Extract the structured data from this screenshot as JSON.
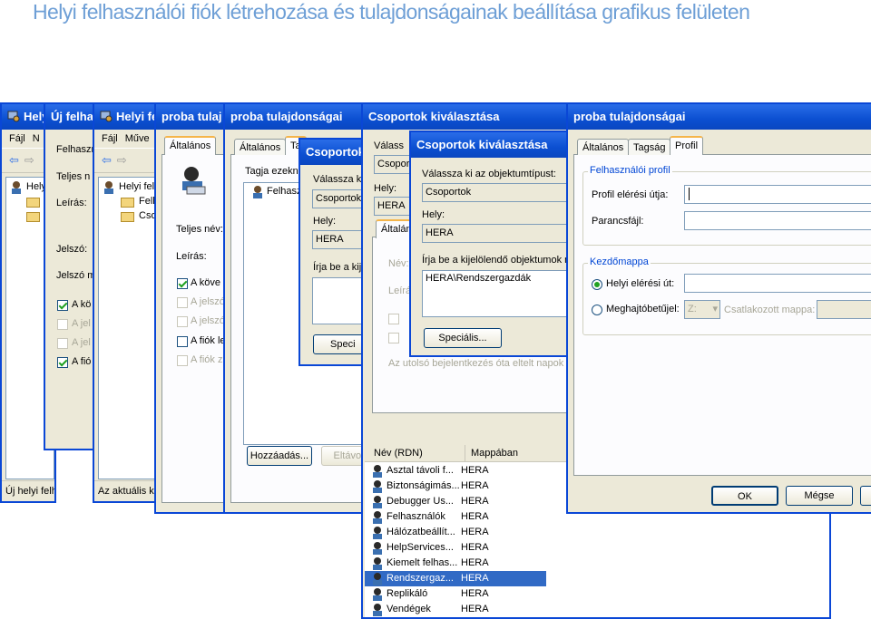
{
  "slide": {
    "title": "Helyi felhasználói fiók létrehozása és tulajdonságainak beállítása grafikus felületen"
  },
  "win1": {
    "title": "Hely",
    "menu": [
      "Fájl",
      "N"
    ],
    "tree": [
      "Hely"
    ],
    "status": "Új helyi felhasználói"
  },
  "win2": {
    "title": "Új felha",
    "labels": {
      "username": "Felhaszn",
      "fullname": "Teljes n",
      "desc": "Leírás:",
      "password": "Jelszó:",
      "password_confirm": "Jelszó m"
    },
    "checks": [
      {
        "label": "A kö",
        "checked": true,
        "disabled": false
      },
      {
        "label": "A jel",
        "checked": false,
        "disabled": true
      },
      {
        "label": "A jel",
        "checked": false,
        "disabled": true
      },
      {
        "label": "A fió",
        "checked": true,
        "disabled": false
      }
    ]
  },
  "win3": {
    "title": "Helyi fe",
    "menu": [
      "Fájl",
      "Műve"
    ],
    "tree": [
      "Helyi fel",
      "Felh",
      "Csop"
    ],
    "status": "Az aktuális ki"
  },
  "win4": {
    "title": "proba tulaj",
    "tab": "Általános",
    "labels": {
      "fullname": "Teljes név:",
      "desc": "Leírás:"
    },
    "checks": [
      {
        "label": "A köve",
        "checked": true,
        "disabled": false
      },
      {
        "label": "A jelszó",
        "checked": false,
        "disabled": true
      },
      {
        "label": "A jelszó",
        "checked": false,
        "disabled": true
      },
      {
        "label": "A fiók le",
        "checked": false,
        "disabled": false
      },
      {
        "label": "A fiók z",
        "checked": false,
        "disabled": true
      }
    ]
  },
  "win5": {
    "title": "proba tulajdonságai",
    "tabs": [
      "Általános",
      "Ta"
    ],
    "member_label": "Tagja ezekn",
    "member_item": "Felhasz",
    "add_button": "Hozzáadás...",
    "remove_button": "Eltávol"
  },
  "win6": {
    "title": "Csoportok",
    "choose_label": "Válassza ki",
    "type_value": "Csoportok",
    "location_label": "Hely:",
    "location_value": "HERA",
    "enter_label": "Írja be a kije",
    "advanced_button": "Speci"
  },
  "win7": {
    "title": "Csoportok kiválasztása",
    "choose_label": "Válass",
    "type_value": "Csopor",
    "location_label": "Hely:",
    "location_value": "HERA",
    "tab": "Általán",
    "name_label": "Név:",
    "desc_label": "Leírá",
    "last_login_text": "Az utolsó bejelentkezés óta eltelt napok s",
    "columns": [
      "Név (RDN)",
      "Mappában"
    ],
    "rows": [
      {
        "name": "Asztal távoli f...",
        "folder": "HERA",
        "selected": false
      },
      {
        "name": "Biztonságimás...",
        "folder": "HERA",
        "selected": false
      },
      {
        "name": "Debugger Us...",
        "folder": "HERA",
        "selected": false
      },
      {
        "name": "Felhasználók",
        "folder": "HERA",
        "selected": false
      },
      {
        "name": "Hálózatbeállít...",
        "folder": "HERA",
        "selected": false
      },
      {
        "name": "HelpServices...",
        "folder": "HERA",
        "selected": false
      },
      {
        "name": "Kiemelt felhas...",
        "folder": "HERA",
        "selected": false
      },
      {
        "name": "Rendszergaz...",
        "folder": "HERA",
        "selected": true
      },
      {
        "name": "Replikáló",
        "folder": "HERA",
        "selected": false
      },
      {
        "name": "Vendégek",
        "folder": "HERA",
        "selected": false
      }
    ]
  },
  "win8": {
    "title": "Csoportok kiválasztása",
    "type_label": "Válassza ki az objektumtípust:",
    "type_value": "Csoportok",
    "location_label": "Hely:",
    "location_value": "HERA",
    "enter_label": "Írja be a kijelölendő objektumok n",
    "entered_value": "HERA\\Rendszergazdák",
    "advanced_button": "Speciális..."
  },
  "win9": {
    "title": "proba tulajdonságai",
    "tabs": [
      "Általános",
      "Tagság",
      "Profil"
    ],
    "profile_group": "Felhasználói profil",
    "profile_path_label": "Profil elérési útja:",
    "logon_script_label": "Parancsfájl:",
    "home_group": "Kezdőmappa",
    "local_path_label": "Helyi elérési út:",
    "connect_label": "Meghajtóbetűjel:",
    "drive_value": "Z:",
    "connect_to_label": "Csatlakozott mappa:",
    "ok_button": "OK",
    "cancel_button": "Mégse"
  },
  "colors": {
    "title_accent": "#6e9fd6",
    "xp_blue": "#0a47d6",
    "xp_face": "#ece9d8",
    "selection": "#316ac5"
  }
}
